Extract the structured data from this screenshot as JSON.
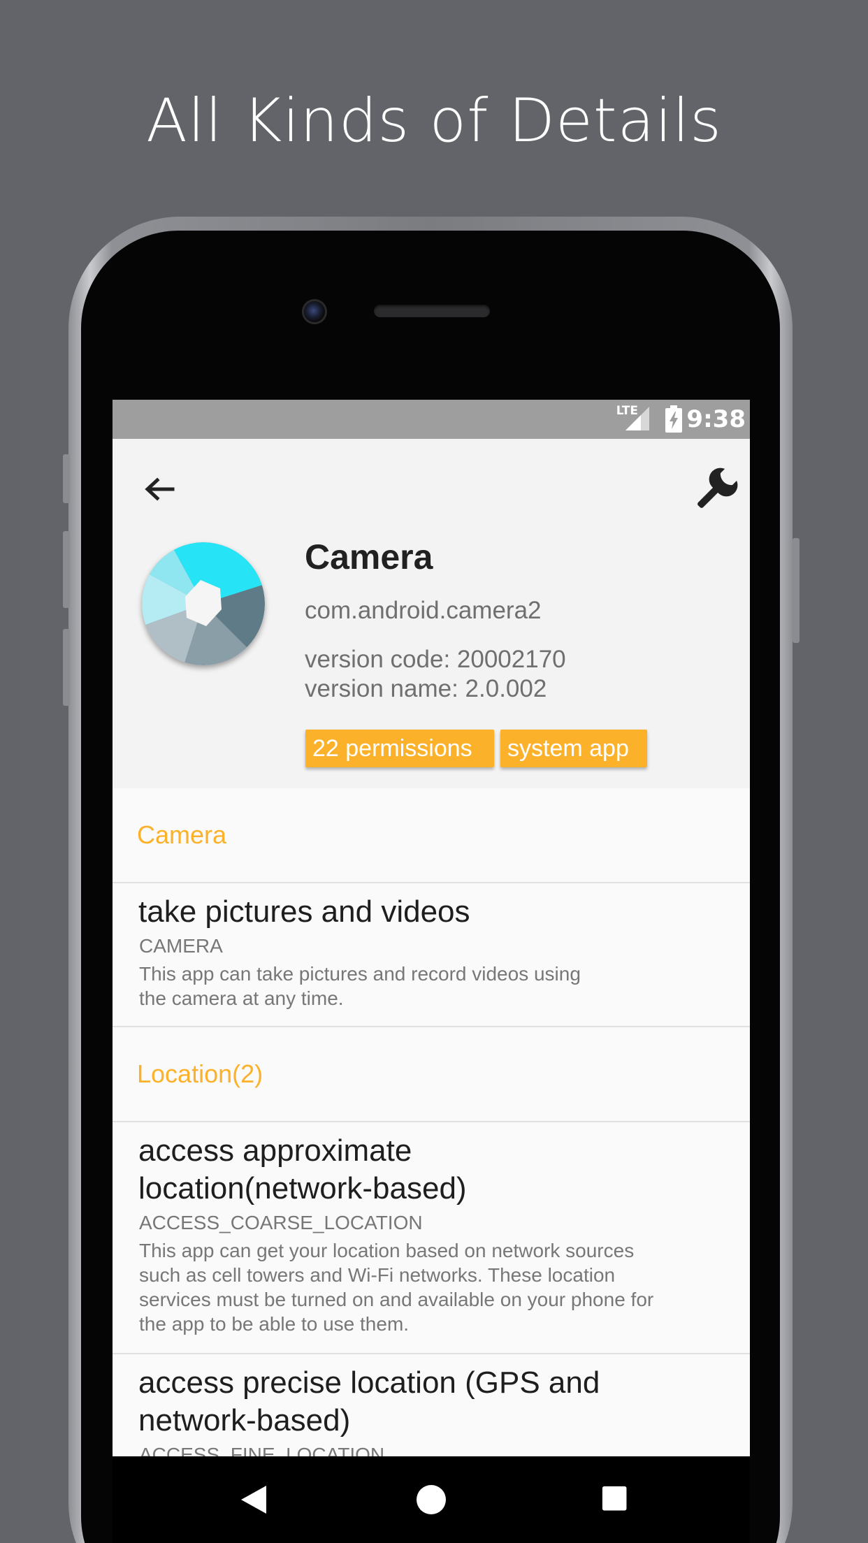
{
  "promo": {
    "title": "All Kinds of Details"
  },
  "status_bar": {
    "network": "LTE",
    "time": "9:38",
    "icons": [
      "signal-icon",
      "battery-charging-icon"
    ]
  },
  "toolbar": {
    "back_icon": "arrow-back-icon",
    "settings_icon": "wrench-icon"
  },
  "app": {
    "icon": "camera-aperture-icon",
    "name": "Camera",
    "package": "com.android.camera2",
    "version_code": "version code: 20002170",
    "version_name": "version name: 2.0.002",
    "chips": {
      "permissions": "22 permissions",
      "system": "system app"
    }
  },
  "sections": [
    {
      "title": "Camera",
      "items": [
        {
          "title": "take pictures and videos",
          "constant": "CAMERA",
          "desc_lines": [
            "This app can take pictures and record videos using",
            "the camera at any time."
          ]
        }
      ]
    },
    {
      "title": "Location(2)",
      "items": [
        {
          "title_lines": [
            "access approximate",
            "location(network-based)"
          ],
          "constant": "ACCESS_COARSE_LOCATION",
          "desc_lines": [
            "This app can get your location based on network sources",
            "such as cell towers and Wi-Fi networks. These location",
            "services must be turned on and available on your phone for",
            "the app to be able to use them."
          ]
        },
        {
          "title_lines": [
            "access precise location (GPS and",
            "network-based)"
          ],
          "constant": "ACCESS_FINE_LOCATION"
        }
      ]
    }
  ],
  "nav_bar": {
    "back": "nav-back-icon",
    "home": "nav-home-icon",
    "recents": "nav-recents-icon"
  },
  "colors": {
    "background": "#636469",
    "accent": "#fbb22a",
    "status_bar": "#9e9e9e",
    "header_bg": "#f3f3f3"
  }
}
